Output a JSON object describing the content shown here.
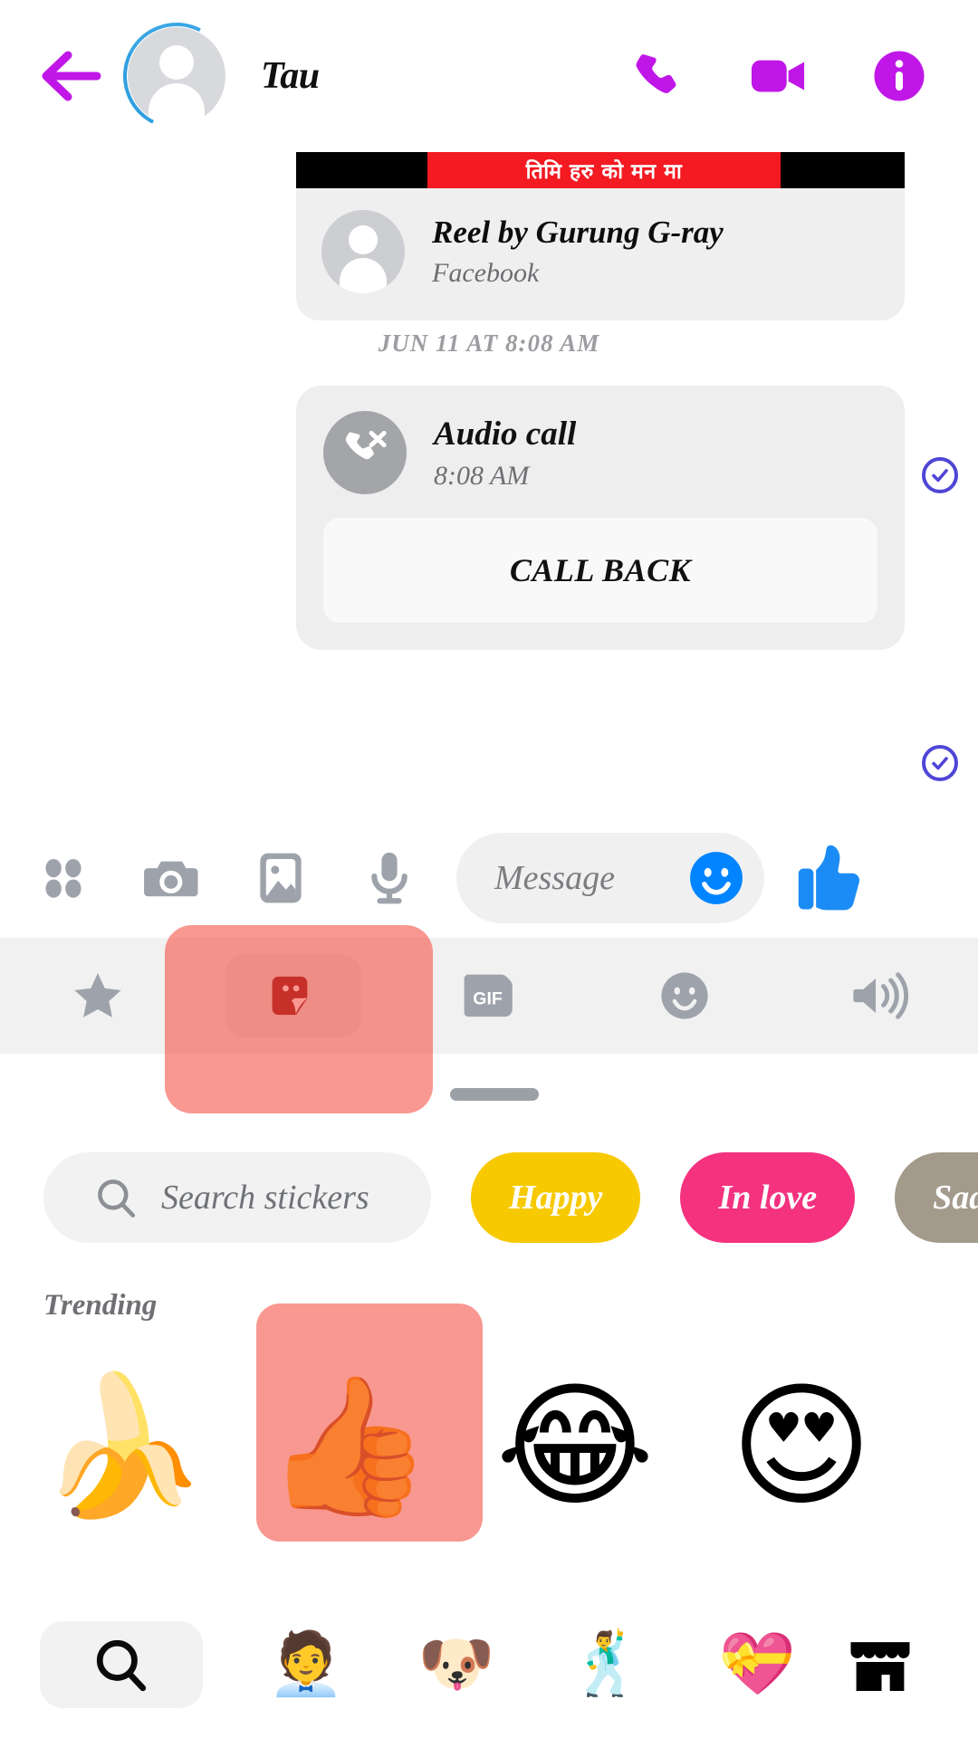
{
  "header": {
    "back_icon": "arrow-left-icon",
    "title": "Tau",
    "avatar_icon": "avatar-placeholder-icon",
    "actions": [
      {
        "name": "audio-call-button",
        "icon": "phone-icon"
      },
      {
        "name": "video-call-button",
        "icon": "video-camera-icon"
      },
      {
        "name": "conversation-info-button",
        "icon": "info-circle-icon"
      }
    ],
    "accent_color": "#c017e8"
  },
  "thread": {
    "reel_message": {
      "thumbnail_caption": "तिमि हरु को मन मा",
      "title": "Reel by Gurung G-ray",
      "source": "Facebook",
      "delivery_status": "delivered",
      "status_icon": "check-circle-icon"
    },
    "day_divider": "JUN 11 AT 8:08 AM",
    "call_message": {
      "icon": "missed-call-icon",
      "title": "Audio call",
      "time": "8:08 AM",
      "action_label": "CALL BACK",
      "delivery_status": "delivered",
      "status_icon": "check-circle-icon"
    },
    "tick_color": "#4f46d6"
  },
  "composer": {
    "items": [
      {
        "name": "more-apps-button",
        "icon": "four-dots-icon"
      },
      {
        "name": "camera-button",
        "icon": "camera-icon"
      },
      {
        "name": "gallery-button",
        "icon": "image-icon"
      },
      {
        "name": "voice-record-button",
        "icon": "microphone-icon"
      }
    ],
    "input_placeholder": "Message",
    "emoji_button_icon": "smiley-face-icon",
    "like_button_icon": "thumbs-up-icon",
    "emoji_color": "#0084ff",
    "like_color": "#1b8cf5"
  },
  "sticker_tray": {
    "tabs": [
      {
        "name": "tab-favorites",
        "icon": "star-icon",
        "label": "",
        "active": false
      },
      {
        "name": "tab-stickers",
        "icon": "sticker-icon",
        "label": "",
        "active": true
      },
      {
        "name": "tab-gifs",
        "icon": "gif-icon",
        "label": "GIF",
        "active": false
      },
      {
        "name": "tab-emoji",
        "icon": "smiley-outline-icon",
        "label": "",
        "active": false
      },
      {
        "name": "tab-sounds",
        "icon": "speaker-icon",
        "label": "",
        "active": false
      }
    ],
    "drag_handle": "drag-handle",
    "search": {
      "icon": "search-icon",
      "placeholder": "Search stickers"
    },
    "categories": [
      {
        "label": "Happy",
        "color": "#f7c900"
      },
      {
        "label": "In love",
        "color": "#f4327f"
      },
      {
        "label": "Sad",
        "color": "#a39a8c"
      }
    ],
    "section_title": "Trending",
    "stickers": [
      {
        "name": "sticker-banana-eyes",
        "glyph": "🍌",
        "highlighted": false
      },
      {
        "name": "sticker-thumbs-up",
        "glyph": "👍",
        "highlighted": true
      },
      {
        "name": "sticker-joy-face",
        "glyph": "😂",
        "highlighted": false
      },
      {
        "name": "sticker-heart-eyes",
        "glyph": "😍",
        "highlighted": false
      }
    ],
    "packs": [
      {
        "name": "pack-search-button",
        "glyph": "",
        "icon": "search-icon"
      },
      {
        "name": "pack-avatar",
        "glyph": "🧑‍💼"
      },
      {
        "name": "pack-dog",
        "glyph": "🐶"
      },
      {
        "name": "pack-action-hero",
        "glyph": "🕺"
      },
      {
        "name": "pack-love-heart",
        "glyph": "💝"
      },
      {
        "name": "pack-store-button",
        "glyph": "",
        "icon": "store-icon"
      }
    ]
  },
  "highlight": {
    "color": "#f44336",
    "targets": [
      "tab-stickers",
      "sticker-thumbs-up"
    ]
  }
}
